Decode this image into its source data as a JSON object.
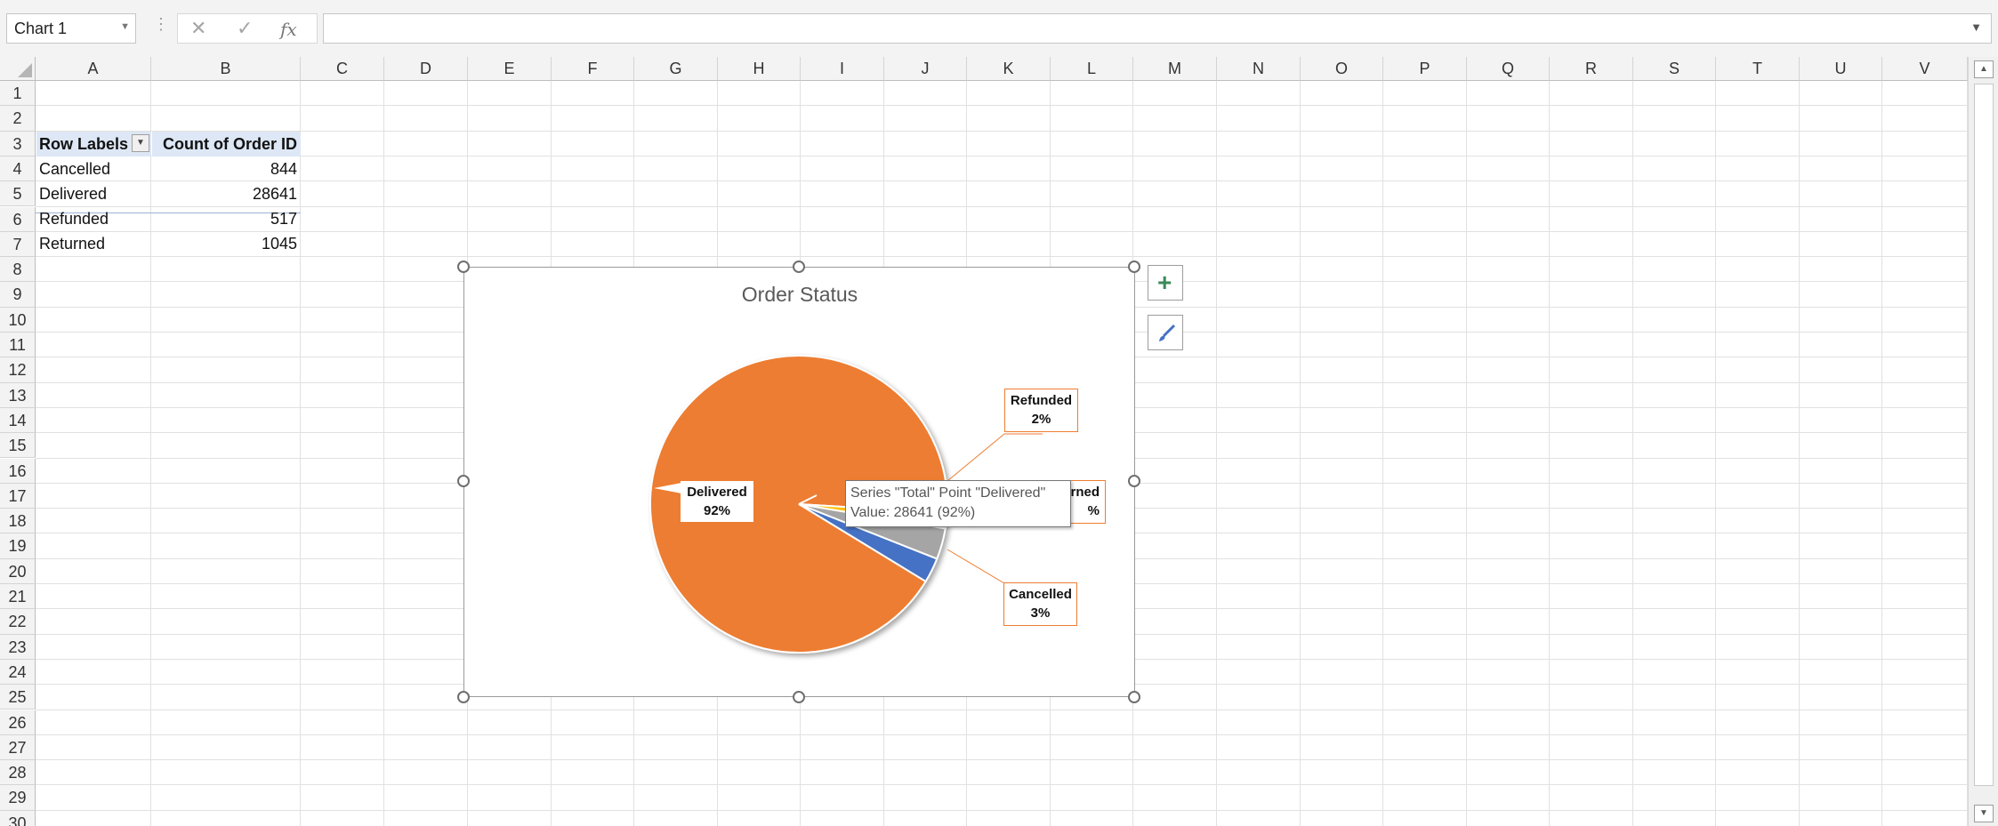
{
  "formula_bar": {
    "name_box": "Chart 1",
    "cancel_icon": "x-icon",
    "enter_icon": "check-icon",
    "fx_label": "fx",
    "formula_value": ""
  },
  "columns": [
    "A",
    "B",
    "C",
    "D",
    "E",
    "F",
    "G",
    "H",
    "I",
    "J",
    "K",
    "L",
    "M",
    "N",
    "O",
    "P",
    "Q",
    "R",
    "S",
    "T",
    "U",
    "V"
  ],
  "rows": [
    "1",
    "2",
    "3",
    "4",
    "5",
    "6",
    "7",
    "8",
    "9",
    "10",
    "11",
    "12",
    "13",
    "14",
    "15",
    "16",
    "17",
    "18",
    "19",
    "20",
    "21",
    "22",
    "23",
    "24",
    "25",
    "26",
    "27",
    "28",
    "29",
    "30"
  ],
  "pivot": {
    "header_row_labels": "Row Labels",
    "header_value": "Count of Order ID",
    "rows": [
      {
        "label": "Cancelled",
        "value": "844"
      },
      {
        "label": "Delivered",
        "value": "28641"
      },
      {
        "label": "Refunded",
        "value": "517"
      },
      {
        "label": "Returned",
        "value": "1045"
      }
    ]
  },
  "chart": {
    "title": "Order Status",
    "labels": {
      "delivered": {
        "name": "Delivered",
        "pct": "92%"
      },
      "refunded": {
        "name": "Refunded",
        "pct": "2%"
      },
      "returned": {
        "name": "rned",
        "pct": "%"
      },
      "cancelled": {
        "name": "Cancelled",
        "pct": "3%"
      }
    },
    "tooltip": {
      "line1": "Series \"Total\" Point \"Delivered\"",
      "line2": "Value: 28641 (92%)"
    },
    "colors": {
      "delivered": "#ed7d31",
      "returned": "#a5a5a5",
      "refunded": "#ffc000",
      "cancelled": "#4472c4"
    }
  },
  "chart_data": {
    "type": "pie",
    "title": "Order Status",
    "categories": [
      "Cancelled",
      "Delivered",
      "Refunded",
      "Returned"
    ],
    "series": [
      {
        "name": "Total",
        "values": [
          844,
          28641,
          517,
          1045
        ]
      }
    ],
    "percent_labels": [
      "3%",
      "92%",
      "2%",
      "3%"
    ]
  },
  "chart_tools": {
    "add_element_icon": "plus-icon",
    "style_icon": "brush-icon"
  }
}
